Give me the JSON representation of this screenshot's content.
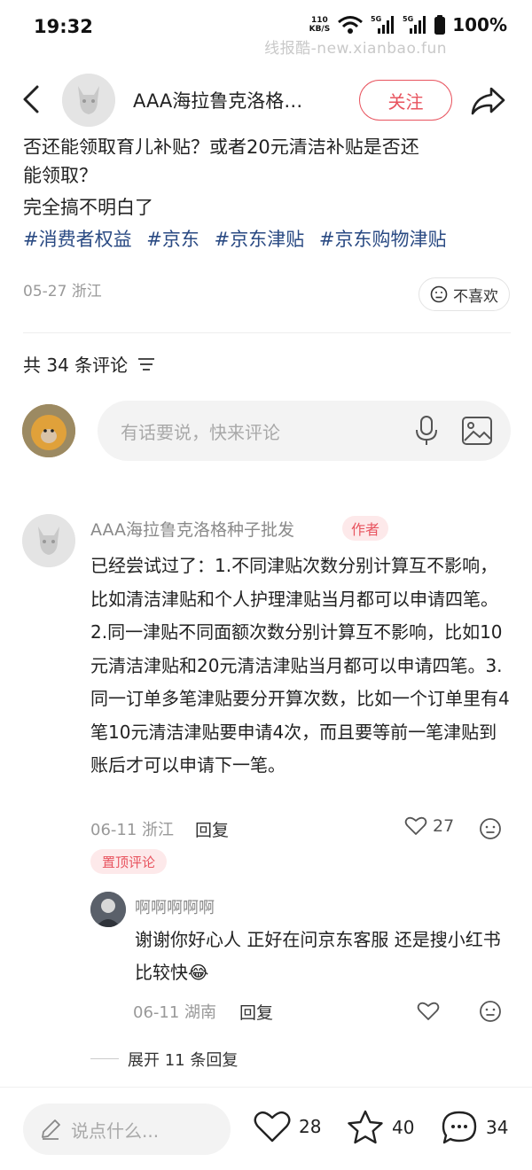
{
  "status_bar": {
    "time": "19:32",
    "net_speed_value": "110",
    "net_speed_unit": "KB/S",
    "signal1_label": "5G",
    "signal2_label": "5G",
    "battery": "100%",
    "watermark": "线报酷-new.xianbao.fun"
  },
  "header": {
    "author_name": "AAA海拉鲁克洛格…",
    "follow_label": "关注"
  },
  "post": {
    "clipped_line": "否还能领取育儿补贴？或者20元清洁补贴是否还",
    "line_2": "能领取？",
    "line_3": "完全搞不明白了",
    "tags": [
      "#消费者权益",
      "#京东",
      "#京东津贴",
      "#京东购物津贴"
    ],
    "meta": "05-27 浙江",
    "dislike_label": "不喜欢"
  },
  "comments_section": {
    "count_label": "共 34 条评论",
    "input_placeholder": "有话要说，快来评论"
  },
  "comment": {
    "author": "AAA海拉鲁克洛格种子批发",
    "author_badge": "作者",
    "text": "已经尝试过了：1.不同津贴次数分别计算互不影响，比如清洁津贴和个人护理津贴当月都可以申请四笔。2.同一津贴不同面额次数分别计算互不影响，比如10元清洁津贴和20元清洁津贴当月都可以申请四笔。3.同一订单多笔津贴要分开算次数，比如一个订单里有4笔10元清洁津贴要申请4次，而且要等前一笔津贴到账后才可以申请下一笔。",
    "meta": "06-11 浙江",
    "reply_label": "回复",
    "likes": "27",
    "pinned_label": "置顶评论"
  },
  "reply": {
    "author": "啊啊啊啊啊",
    "text": "谢谢你好心人 正好在问京东客服 还是搜小红书比较快😂",
    "meta": "06-11 湖南",
    "reply_label": "回复"
  },
  "expand_label": "展开 11 条回复",
  "bottom_bar": {
    "placeholder": "说点什么...",
    "likes": "28",
    "favorites": "40",
    "comments": "34"
  },
  "colors": {
    "accent": "#e8545f",
    "tag": "#2a4a83",
    "muted": "#999999"
  }
}
